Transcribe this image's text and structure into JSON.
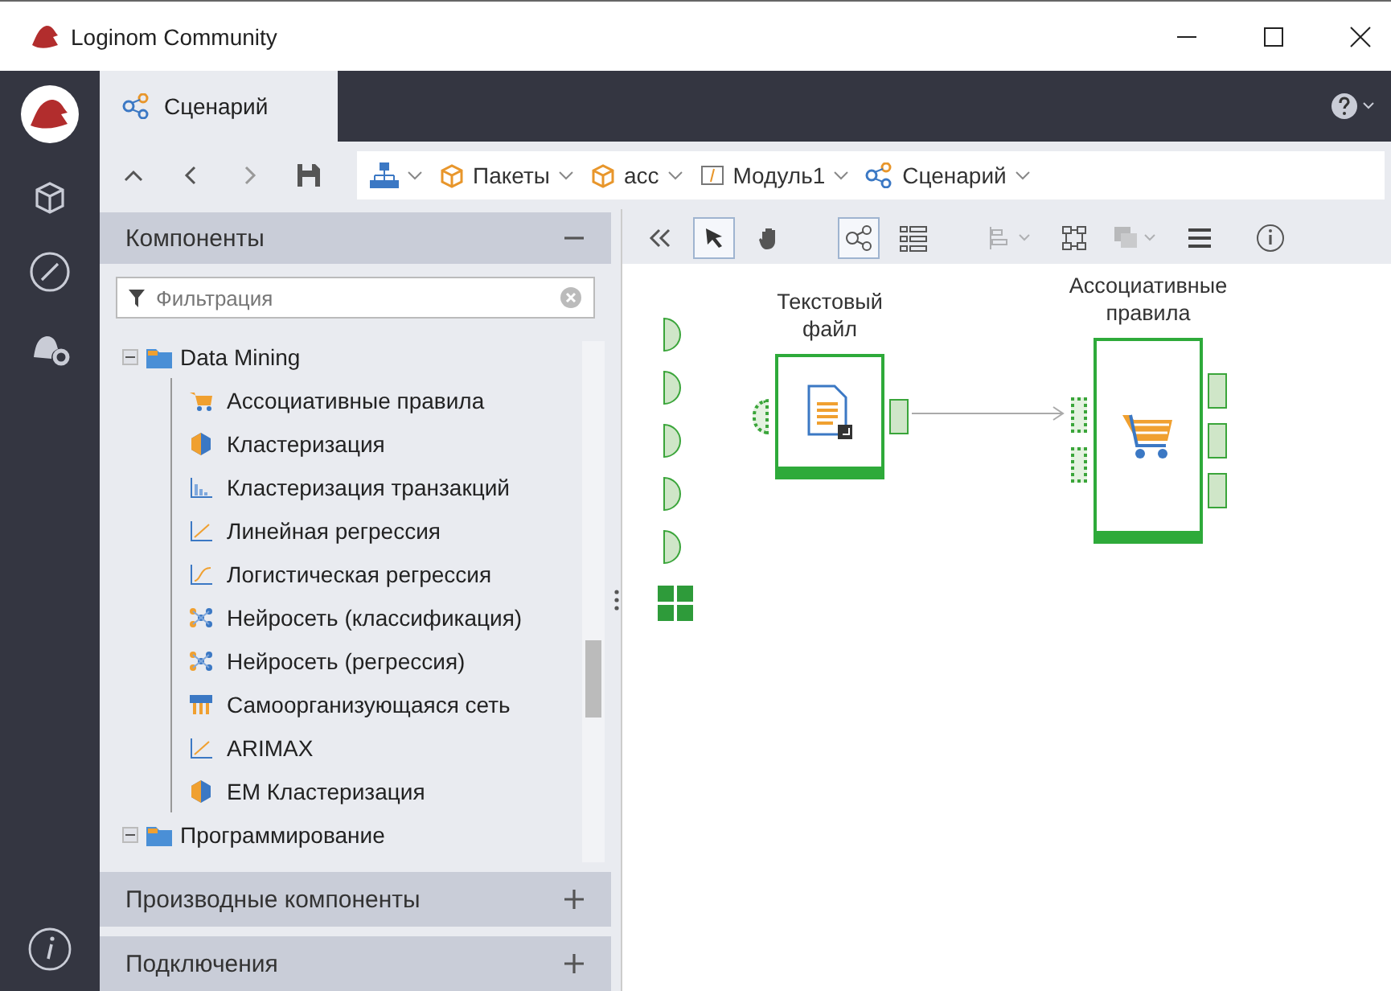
{
  "window": {
    "title": "Loginom Community"
  },
  "tab": {
    "label": "Сценарий",
    "selected": true
  },
  "breadcrumbs": [
    {
      "kind": "tree"
    },
    {
      "kind": "package",
      "label": "Пакеты"
    },
    {
      "kind": "package",
      "label": "acc"
    },
    {
      "kind": "module",
      "label": "Модуль1"
    },
    {
      "kind": "scenario",
      "label": "Сценарий"
    }
  ],
  "components": {
    "title": "Компоненты",
    "expanded": true,
    "filter": {
      "placeholder": "Фильтрация"
    },
    "tree": [
      {
        "label": "Data Mining",
        "expanded": true,
        "children": [
          {
            "label": "Ассоциативные правила",
            "kind": "cart"
          },
          {
            "label": "Кластеризация",
            "kind": "cluster"
          },
          {
            "label": "Кластеризация транзакций",
            "kind": "bars"
          },
          {
            "label": "Линейная регрессия",
            "kind": "linear"
          },
          {
            "label": "Логистическая регрессия",
            "kind": "logistic"
          },
          {
            "label": "Нейросеть (классификация)",
            "kind": "net"
          },
          {
            "label": "Нейросеть (регрессия)",
            "kind": "net"
          },
          {
            "label": "Самоорганизующаяся сеть",
            "kind": "som"
          },
          {
            "label": "ARIMAX",
            "kind": "linear"
          },
          {
            "label": "EM Кластеризация",
            "kind": "cluster"
          }
        ]
      },
      {
        "label": "Программирование",
        "expanded": true
      }
    ]
  },
  "panels": [
    {
      "title": "Производные компоненты",
      "expanded": false
    },
    {
      "title": "Подключения",
      "expanded": false
    }
  ],
  "tools": [
    {
      "kind": "collapse",
      "selected": false,
      "disabled": false
    },
    {
      "kind": "pointer",
      "selected": true,
      "disabled": false
    },
    {
      "kind": "hand",
      "selected": false,
      "disabled": false
    },
    {
      "kind": "gap"
    },
    {
      "kind": "graph",
      "selected": true,
      "disabled": false
    },
    {
      "kind": "list",
      "selected": false,
      "disabled": false
    },
    {
      "kind": "gap"
    },
    {
      "kind": "align",
      "selected": false,
      "disabled": true
    },
    {
      "kind": "layout",
      "selected": false,
      "disabled": false
    },
    {
      "kind": "stack",
      "selected": false,
      "disabled": true
    },
    {
      "kind": "menu",
      "selected": false,
      "disabled": false
    },
    {
      "kind": "gap"
    },
    {
      "kind": "info",
      "selected": false,
      "disabled": false
    }
  ],
  "nodes": [
    {
      "label": "Текстовый файл",
      "kind": "textfile"
    },
    {
      "label": "Ассоциативные правила",
      "kind": "cart"
    }
  ]
}
